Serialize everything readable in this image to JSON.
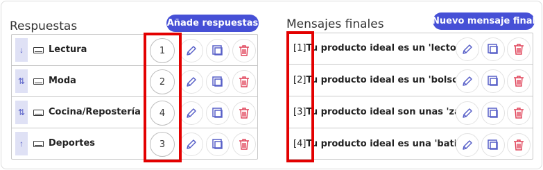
{
  "answers": {
    "title": "Respuestas",
    "add_button": "Añade respuestas",
    "rows": [
      {
        "arrow": "↓",
        "label": "Lectura",
        "count": "1"
      },
      {
        "arrow": "⇅",
        "label": "Moda",
        "count": "2"
      },
      {
        "arrow": "⇅",
        "label": "Cocina/Repostería",
        "count": "4"
      },
      {
        "arrow": "↑",
        "label": "Deportes",
        "count": "3"
      }
    ]
  },
  "final_messages": {
    "title": "Mensajes finales",
    "add_button": "Nuevo mensaje final",
    "rows": [
      {
        "index": "[1]",
        "text": "Tu producto ideal es un 'lector de libros'"
      },
      {
        "index": "[2]",
        "text": "Tu producto ideal es un 'bolso'. ¡Tu estilo!"
      },
      {
        "index": "[3]",
        "text": "Tu producto ideal son unas 'zapatillas'"
      },
      {
        "index": "[4]",
        "text": "Tu producto ideal es una 'batidora'"
      }
    ]
  },
  "icons": {
    "edit": "pencil-icon",
    "duplicate": "copy-icon",
    "delete": "trash-icon"
  },
  "colors": {
    "accent": "#4650d6",
    "edit": "#5860c8",
    "delete": "#e0445a",
    "highlight": "#e30000"
  }
}
